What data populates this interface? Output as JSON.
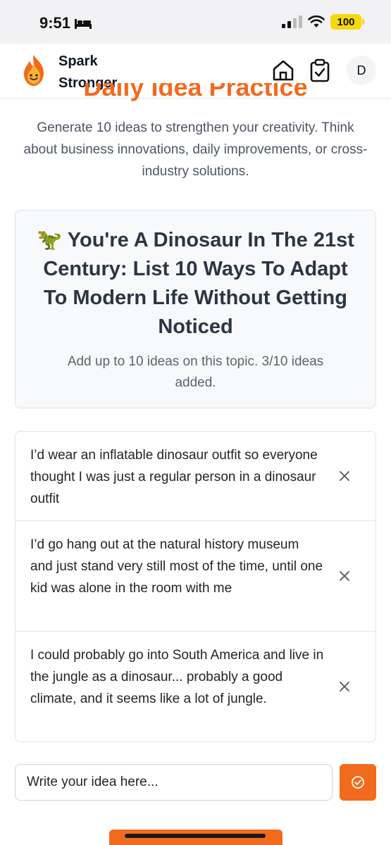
{
  "status_bar": {
    "time": "9:51",
    "battery": "100"
  },
  "brand": {
    "name": "Spark Stronger"
  },
  "user": {
    "initial": "D"
  },
  "page": {
    "title": "Daily Idea Practice",
    "intro": "Generate 10 ideas to strengthen your creativity. Think about business innovations, daily improvements, or cross-industry solutions."
  },
  "topic": {
    "emoji": "🦖",
    "title": "You're A Dinosaur In The 21st Century: List 10 Ways To Adapt To Modern Life Without Getting Noticed",
    "subtitle": "Add up to 10 ideas on this topic. 3/10 ideas added."
  },
  "ideas": [
    {
      "text": "I’d wear an inflatable dinosaur outfit so everyone thought I was just a regular person in a dinosaur outfit"
    },
    {
      "text": "I’d go hang out at the natural history museum and just stand very still most of the time, until one kid was alone in the room with me"
    },
    {
      "text": "I could probably go into South America and live in the jungle as a dinosaur... probably a good climate, and it seems like a lot of jungle."
    }
  ],
  "input": {
    "placeholder": "Write your idea here..."
  },
  "icons": {
    "logo": "flame-logo-icon",
    "home": "home-icon",
    "tasks": "clipboard-check-icon",
    "remove": "close-icon",
    "submit": "check-circle-icon",
    "sleep": "bed-icon",
    "wifi": "wifi-icon"
  },
  "colors": {
    "accent": "#f26b1d",
    "card_bg": "#f8f9fa",
    "border": "#dfe2e6"
  }
}
